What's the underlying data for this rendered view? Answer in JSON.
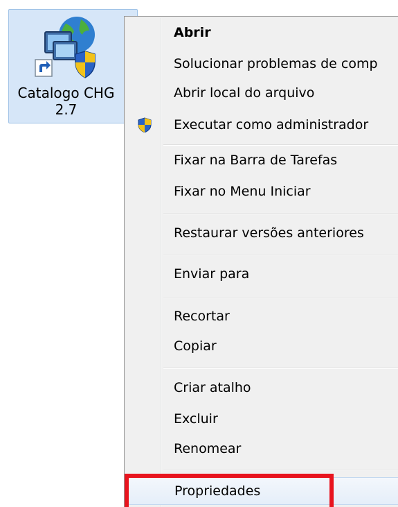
{
  "desktop_icon": {
    "label_line1": "Catalogo CHG",
    "label_line2": "2.7",
    "icon": "network-globe-shortcut-icon",
    "selected": true
  },
  "context_menu": {
    "items": [
      {
        "label": "Abrir",
        "bold": true
      },
      {
        "label": "Solucionar problemas de comp"
      },
      {
        "label": "Abrir local do arquivo"
      },
      {
        "label": "Executar como administrador",
        "icon": "uac-shield-icon"
      },
      {
        "label": "Fixar na Barra de Tarefas"
      },
      {
        "label": "Fixar no Menu Iniciar"
      },
      {
        "label": "Restaurar versões anteriores"
      },
      {
        "label": "Enviar para"
      },
      {
        "label": "Recortar"
      },
      {
        "label": "Copiar"
      },
      {
        "label": "Criar atalho"
      },
      {
        "label": "Excluir"
      },
      {
        "label": "Renomear"
      },
      {
        "label": "Propriedades",
        "highlighted": true
      }
    ]
  },
  "annotation": {
    "color": "#e8141e",
    "target": "Propriedades"
  }
}
